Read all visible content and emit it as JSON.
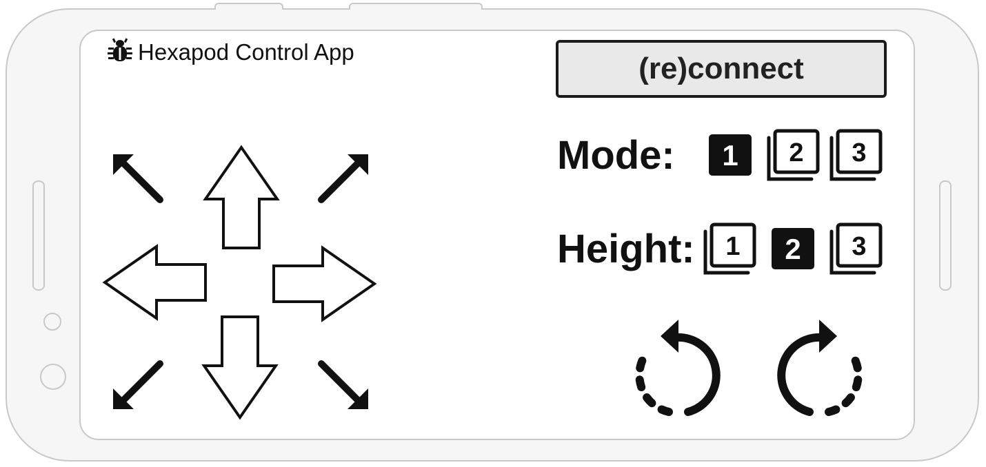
{
  "app": {
    "title": "Hexapod Control App",
    "icon": "bug-icon"
  },
  "connection": {
    "reconnect_label": "(re)connect"
  },
  "mode": {
    "label": "Mode:",
    "options": [
      "1",
      "2",
      "3"
    ],
    "selected": "1"
  },
  "height": {
    "label": "Height:",
    "options": [
      "1",
      "2",
      "3"
    ],
    "selected": "2"
  },
  "directions": {
    "icons": [
      "arrow-up-left-icon",
      "arrow-up-icon",
      "arrow-up-right-icon",
      "arrow-left-icon",
      "arrow-right-icon",
      "arrow-down-left-icon",
      "arrow-down-icon",
      "arrow-down-right-icon"
    ]
  },
  "rotation": {
    "icons": [
      "rotate-left-icon",
      "rotate-right-icon"
    ]
  },
  "colors": {
    "phone_frame": "#c8c8c8",
    "button_bg": "#e9e9e9",
    "ink": "#111111"
  }
}
